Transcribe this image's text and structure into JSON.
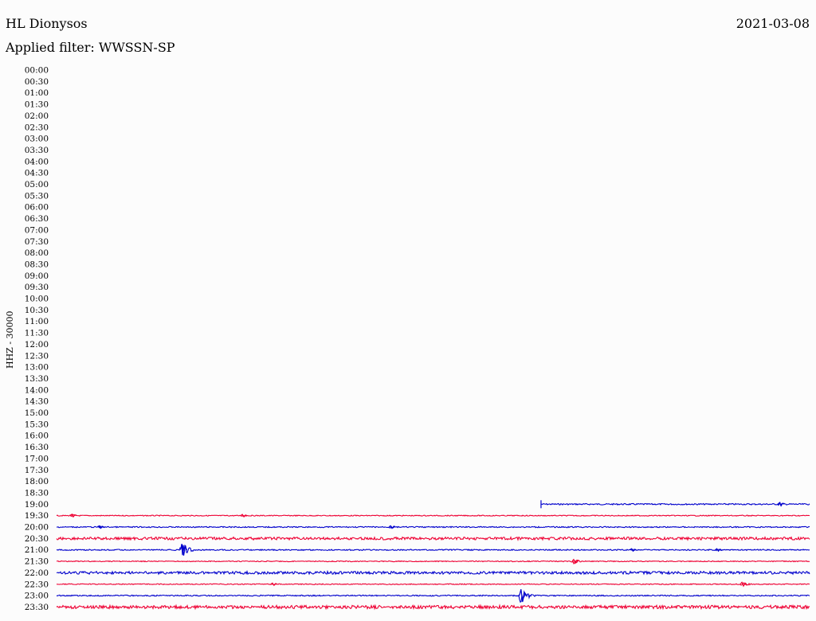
{
  "header": {
    "station": "HL Dionysos",
    "date": "2021-03-08",
    "filter": "Applied filter: WWSSN-SP"
  },
  "colors": {
    "background": "#fcfcfc",
    "trace_blue": "#0000cc",
    "trace_red": "#ee0033",
    "text": "#000000"
  },
  "chart_data": {
    "type": "line",
    "title": "HL Dionysos",
    "subtitle": "Applied filter: WWSSN-SP",
    "ylabel": "HHZ - 30000",
    "xlabel": "",
    "grid": false,
    "legend": "none",
    "ytick_labels": [
      "00:00",
      "00:30",
      "01:00",
      "01:30",
      "02:00",
      "02:30",
      "03:00",
      "03:30",
      "04:00",
      "04:30",
      "05:00",
      "05:30",
      "06:00",
      "06:30",
      "07:00",
      "07:30",
      "08:00",
      "08:30",
      "09:00",
      "09:30",
      "10:00",
      "10:30",
      "11:00",
      "11:30",
      "12:00",
      "12:30",
      "13:00",
      "13:30",
      "14:00",
      "14:30",
      "15:00",
      "15:30",
      "16:00",
      "16:30",
      "17:00",
      "17:30",
      "18:00",
      "18:30",
      "19:00",
      "19:30",
      "20:00",
      "20:30",
      "21:00",
      "21:30",
      "22:00",
      "22:30",
      "23:00",
      "23:30"
    ],
    "rows": [
      {
        "label": "19:00",
        "color": "blue",
        "start_minute": 19.3,
        "events": [
          {
            "minute": 28.8,
            "amp": 0.25
          }
        ],
        "noise": 0.06
      },
      {
        "label": "19:30",
        "color": "red",
        "start_minute": 0,
        "events": [
          {
            "minute": 0.6,
            "amp": 0.2
          },
          {
            "minute": 7.4,
            "amp": 0.1
          }
        ],
        "noise": 0.04
      },
      {
        "label": "20:00",
        "color": "blue",
        "start_minute": 0,
        "events": [
          {
            "minute": 1.7,
            "amp": 0.15
          },
          {
            "minute": 13.3,
            "amp": 0.2
          }
        ],
        "noise": 0.05
      },
      {
        "label": "20:30",
        "color": "red",
        "start_minute": 0,
        "events": [],
        "noise": 0.12
      },
      {
        "label": "21:00",
        "color": "blue",
        "start_minute": 0,
        "events": [
          {
            "minute": 5.0,
            "amp": 0.9
          },
          {
            "minute": 22.9,
            "amp": 0.15
          },
          {
            "minute": 26.3,
            "amp": 0.1
          }
        ],
        "noise": 0.05
      },
      {
        "label": "21:30",
        "color": "red",
        "start_minute": 0,
        "events": [
          {
            "minute": 20.6,
            "amp": 0.3
          }
        ],
        "noise": 0.04
      },
      {
        "label": "22:00",
        "color": "blue",
        "start_minute": 0,
        "events": [],
        "noise": 0.12
      },
      {
        "label": "22:30",
        "color": "red",
        "start_minute": 0,
        "events": [
          {
            "minute": 8.6,
            "amp": 0.1
          },
          {
            "minute": 27.3,
            "amp": 0.3
          }
        ],
        "noise": 0.04
      },
      {
        "label": "23:00",
        "color": "blue",
        "start_minute": 0,
        "events": [
          {
            "minute": 18.5,
            "amp": 1.0
          }
        ],
        "noise": 0.05
      },
      {
        "label": "23:30",
        "color": "red",
        "start_minute": 0,
        "events": [],
        "noise": 0.14
      }
    ]
  }
}
